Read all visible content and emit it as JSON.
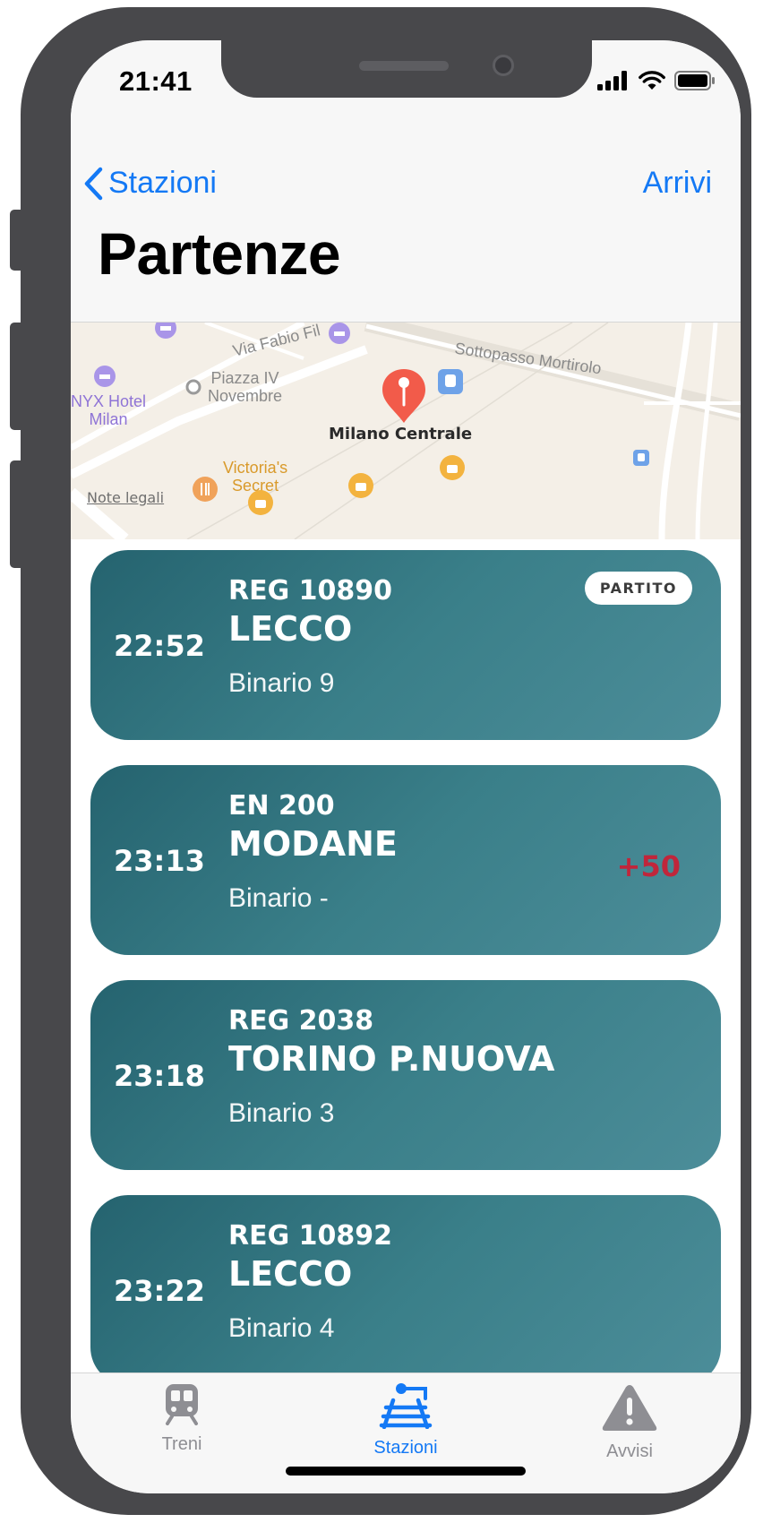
{
  "status_bar": {
    "time": "21:41"
  },
  "nav": {
    "back_label": "Stazioni",
    "right_label": "Arrivi",
    "title": "Partenze"
  },
  "map": {
    "station_name": "Milano Centrale",
    "legal_link": "Note legali",
    "labels": {
      "via_fabio": "Via Fabio Fil",
      "sottopasso": "Sottopasso Mortirolo",
      "piazza_line1": "Piazza IV",
      "piazza_line2": "Novembre",
      "hotel_line1": "NYX Hotel",
      "hotel_line2": "Milan",
      "victoria_line1": "Victoria's",
      "victoria_line2": "Secret"
    },
    "colors": {
      "pin": "#f25b4a",
      "victoria": "#d99a2b"
    }
  },
  "departures": [
    {
      "time": "22:52",
      "train": "REG 10890",
      "destination": "LECCO",
      "platform": "Binario 9",
      "badge": "PARTITO",
      "delay": ""
    },
    {
      "time": "23:13",
      "train": "EN 200",
      "destination": "MODANE",
      "platform": "Binario -",
      "badge": "",
      "delay": "+50"
    },
    {
      "time": "23:18",
      "train": "REG 2038",
      "destination": "TORINO P.NUOVA",
      "platform": "Binario 3",
      "badge": "",
      "delay": ""
    },
    {
      "time": "23:22",
      "train": "REG 10892",
      "destination": "LECCO",
      "platform": "Binario 4",
      "badge": "",
      "delay": ""
    }
  ],
  "tabs": [
    {
      "label": "Treni",
      "icon": "train-icon",
      "active": false
    },
    {
      "label": "Stazioni",
      "icon": "railway-station-icon",
      "active": true
    },
    {
      "label": "Avvisi",
      "icon": "warning-icon",
      "active": false
    }
  ],
  "colors": {
    "accent": "#1479f5",
    "card_gradient_start": "#25636f",
    "card_gradient_end": "#4c8d99",
    "delay": "#c0263b",
    "inactive_tab": "#8e8e93"
  }
}
